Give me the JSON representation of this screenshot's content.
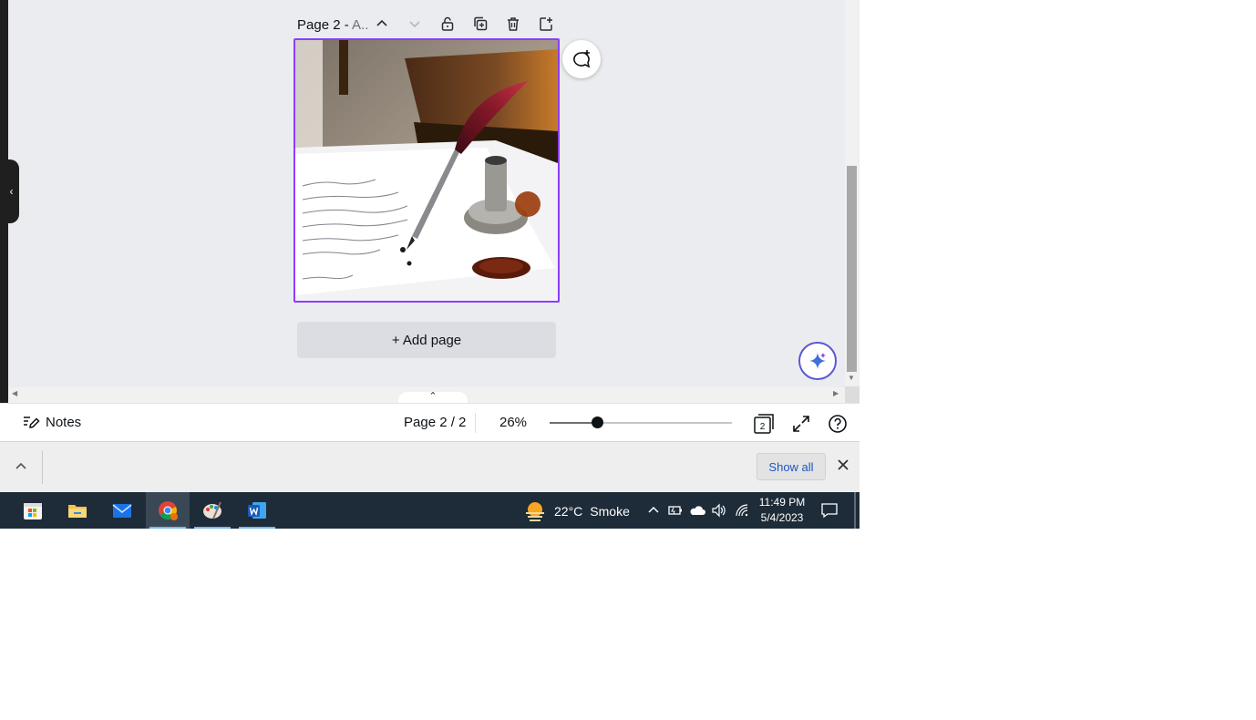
{
  "editor": {
    "page_title_main": "Page 2 - ",
    "page_title_rest": "A..",
    "add_page_label": "+ Add page",
    "toolbar_icons": [
      "chevron-up-icon",
      "chevron-down-icon",
      "lock-icon",
      "duplicate-icon",
      "trash-icon",
      "add-page-icon"
    ],
    "side_panel_toggle": "‹",
    "pull_tab_symbol": "⌃",
    "accent_color": "#8b3dff"
  },
  "bottom_bar": {
    "notes_label": "Notes",
    "page_indicator": "Page 2 / 2",
    "zoom_label": "26%",
    "zoom_fraction": 0.26,
    "page_grid_count": "2"
  },
  "download_bar": {
    "show_all_label": "Show all"
  },
  "taskbar": {
    "apps": [
      "start-icon",
      "file-explorer-icon",
      "mail-icon",
      "chrome-icon",
      "paint-icon",
      "word-icon"
    ],
    "weather_temp": "22°C",
    "weather_desc": "Smoke",
    "time": "11:49 PM",
    "date": "5/4/2023"
  }
}
